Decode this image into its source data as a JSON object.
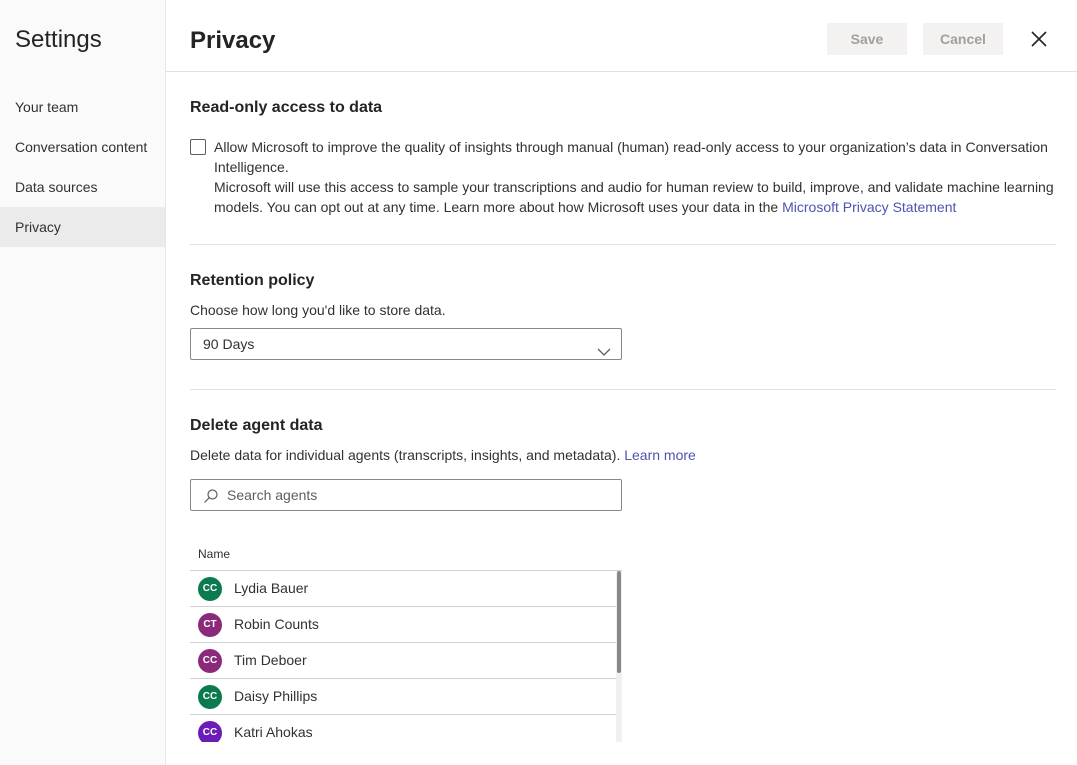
{
  "sidebar": {
    "title": "Settings",
    "items": [
      {
        "label": "Your team"
      },
      {
        "label": "Conversation content"
      },
      {
        "label": "Data sources"
      },
      {
        "label": "Privacy"
      }
    ]
  },
  "header": {
    "title": "Privacy",
    "save_label": "Save",
    "cancel_label": "Cancel"
  },
  "read_only": {
    "title": "Read-only access to data",
    "line1": "Allow Microsoft to improve the quality of insights through manual (human) read-only access to your organization’s data in Conversation Intelligence.",
    "line2": "Microsoft will use this access to sample your transcriptions and audio for human review to build, improve, and validate machine learning models. You can opt out at any time. Learn more about how Microsoft uses your data in the ",
    "link": "Microsoft Privacy Statement"
  },
  "retention": {
    "title": "Retention policy",
    "desc": "Choose how long you'd like to store data.",
    "selected": "90 Days"
  },
  "delete": {
    "title": "Delete agent data",
    "desc": "Delete data for individual agents (transcripts, insights, and metadata). ",
    "link": "Learn more",
    "search_placeholder": "Search agents",
    "column_name": "Name",
    "agents": [
      {
        "initials": "CC",
        "name": "Lydia Bauer",
        "color": "#0b7a4e"
      },
      {
        "initials": "CT",
        "name": "Robin Counts",
        "color": "#8b2a7a"
      },
      {
        "initials": "CC",
        "name": "Tim Deboer",
        "color": "#8b2a7a"
      },
      {
        "initials": "CC",
        "name": "Daisy Phillips",
        "color": "#0b7a4e"
      },
      {
        "initials": "CC",
        "name": "Katri Ahokas",
        "color": "#6a1bb8"
      }
    ]
  }
}
